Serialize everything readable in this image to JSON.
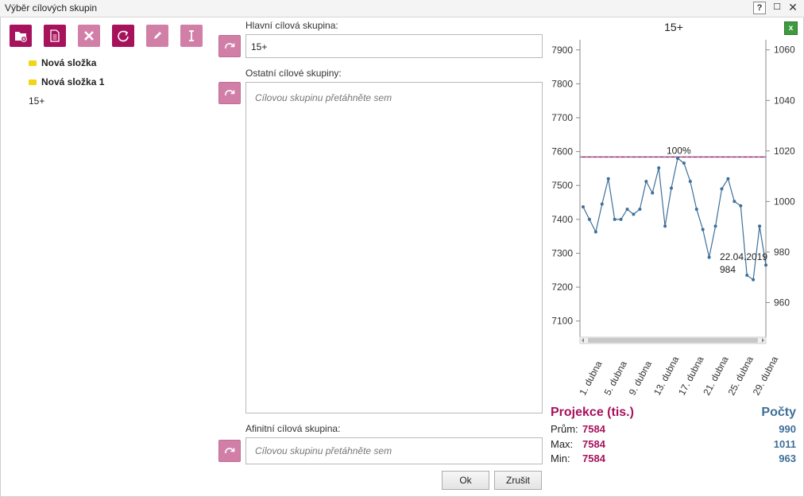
{
  "window": {
    "title": "Výběr cílových skupin",
    "help": "?",
    "maximize": "☐",
    "close": "✕"
  },
  "toolbar": [
    {
      "name": "new-folder-button",
      "icon": "folder-plus-icon"
    },
    {
      "name": "new-document-button",
      "icon": "document-icon"
    },
    {
      "name": "delete-button",
      "icon": "close-icon"
    },
    {
      "name": "refresh-button",
      "icon": "refresh-icon"
    },
    {
      "name": "edit-button",
      "icon": "pencil-icon"
    },
    {
      "name": "rename-button",
      "icon": "text-cursor-icon"
    }
  ],
  "tree": {
    "folder1": "Nová složka",
    "folder2": "Nová složka 1",
    "item": "15+"
  },
  "main_group": {
    "label": "Hlavní cílová skupina:",
    "value": "15+"
  },
  "other_groups": {
    "label": "Ostatní cílové skupiny:",
    "placeholder": "Cílovou skupinu přetáhněte sem"
  },
  "affinity_group": {
    "label": "Afinitní cílová skupina:",
    "placeholder": "Cílovou skupinu přetáhněte sem"
  },
  "buttons": {
    "ok": "Ok",
    "cancel": "Zrušit"
  },
  "chart_title": "15+",
  "excel_label": "x",
  "stats": {
    "left_title": "Projekce (tis.)",
    "right_title": "Počty",
    "rows": [
      {
        "name": "Prům:",
        "projection": "7584",
        "count": "990"
      },
      {
        "name": "Max:",
        "projection": "7584",
        "count": "1011"
      },
      {
        "name": "Min:",
        "projection": "7584",
        "count": "963"
      }
    ]
  },
  "chart_data": {
    "type": "line",
    "x_ticks": [
      "1. dubna",
      "5. dubna",
      "9. dubna",
      "13. dubna",
      "17. dubna",
      "21. dubna",
      "25. dubna",
      "29. dubna"
    ],
    "y_left": {
      "ticks": [
        7100,
        7200,
        7300,
        7400,
        7500,
        7600,
        7700,
        7800,
        7900
      ],
      "range": [
        7050,
        7930
      ]
    },
    "y_right": {
      "ticks": [
        960,
        980,
        1000,
        1020,
        1040,
        1060
      ],
      "range": [
        946,
        1064
      ]
    },
    "reference_line": {
      "value": 7584,
      "label": "100%"
    },
    "series": [
      {
        "values": [
          7437,
          7400,
          7363,
          7445,
          7520,
          7400,
          7400,
          7430,
          7415,
          7430,
          7512,
          7478,
          7552,
          7380,
          7492,
          7580,
          7566,
          7512,
          7430,
          7370,
          7288,
          7380,
          7490,
          7520,
          7453,
          7440,
          7235,
          7222,
          7380,
          7265
        ]
      }
    ],
    "tooltip": {
      "date": "22.04.2019",
      "value": "984"
    },
    "colors": {
      "line": "#3e6f99",
      "reference": "#a6125c"
    }
  }
}
